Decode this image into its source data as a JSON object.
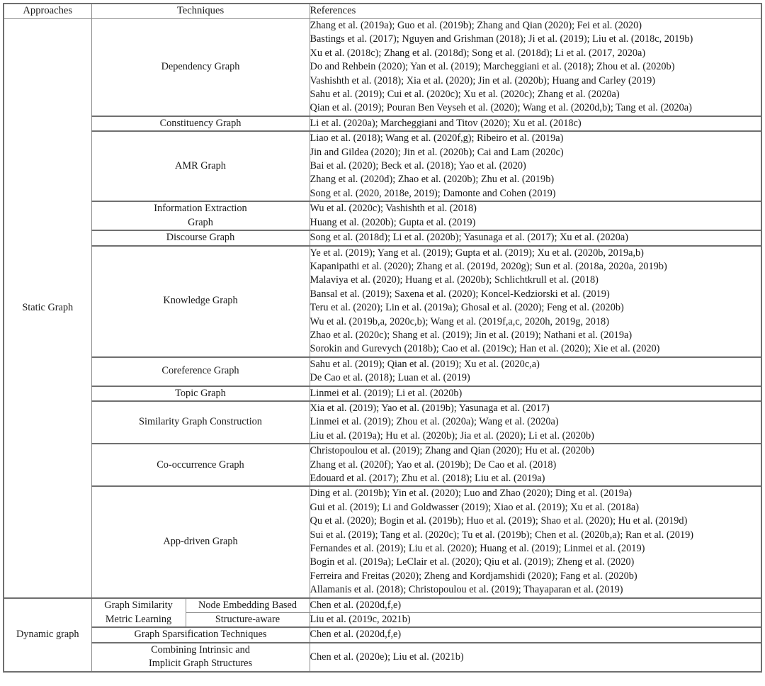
{
  "table": {
    "headers": {
      "approaches": "Approaches",
      "techniques": "Techniques",
      "references": "References"
    },
    "groups": [
      {
        "name": "Static Graph",
        "rows": [
          {
            "technique": "Dependency Graph",
            "references": [
              "Zhang et al. (2019a); Guo et al. (2019b); Zhang and Qian (2020); Fei et al. (2020)",
              "Bastings et al. (2017); Nguyen and Grishman (2018); Ji et al. (2019); Liu et al. (2018c, 2019b)",
              "Xu et al. (2018c); Zhang et al. (2018d); Song et al. (2018d); Li et al. (2017, 2020a)",
              "Do and Rehbein (2020); Yan et al. (2019); Marcheggiani et al. (2018); Zhou et al. (2020b)",
              "Vashishth et al. (2018); Xia et al. (2020); Jin et al. (2020b); Huang and Carley (2019)",
              "Sahu et al. (2019); Cui et al. (2020c); Xu et al. (2020c); Zhang et al. (2020a)",
              "Qian et al. (2019); Pouran Ben Veyseh et al. (2020); Wang et al. (2020d,b); Tang et al. (2020a)"
            ]
          },
          {
            "technique": "Constituency Graph",
            "references": [
              "Li et al. (2020a); Marcheggiani and Titov (2020); Xu et al. (2018c)"
            ]
          },
          {
            "technique": "AMR Graph",
            "references": [
              "Liao et al. (2018); Wang et al. (2020f,g); Ribeiro et al. (2019a)",
              "Jin and Gildea (2020); Jin et al. (2020b); Cai and Lam (2020c)",
              "Bai et al. (2020); Beck et al. (2018); Yao et al. (2020)",
              "Zhang et al. (2020d); Zhao et al. (2020b); Zhu et al. (2019b)",
              "Song et al. (2020, 2018e, 2019); Damonte and Cohen (2019)"
            ]
          },
          {
            "technique": "Information Extraction\nGraph",
            "technique_lines": [
              "Information Extraction",
              "Graph"
            ],
            "references": [
              "Wu et al. (2020c); Vashishth et al. (2018)",
              "Huang et al. (2020b); Gupta et al. (2019)"
            ]
          },
          {
            "technique": "Discourse Graph",
            "references": [
              "Song et al. (2018d); Li et al. (2020b); Yasunaga et al. (2017); Xu et al. (2020a)"
            ]
          },
          {
            "technique": "Knowledge Graph",
            "references": [
              "Ye et al. (2019); Yang et al. (2019); Gupta et al. (2019); Xu et al. (2020b, 2019a,b)",
              "Kapanipathi et al. (2020); Zhang et al. (2019d, 2020g); Sun et al. (2018a, 2020a, 2019b)",
              "Malaviya et al. (2020); Huang et al. (2020b); Schlichtkrull et al. (2018)",
              "Bansal et al. (2019); Saxena et al. (2020); Koncel-Kedziorski et al. (2019)",
              "Teru et al. (2020); Lin et al. (2019a); Ghosal et al. (2020); Feng et al. (2020b)",
              "Wu et al. (2019b,a, 2020c,b); Wang et al. (2019f,a,c, 2020h, 2019g, 2018)",
              "Zhao et al. (2020c); Shang et al. (2019); Jin et al. (2019); Nathani et al. (2019a)",
              "Sorokin and Gurevych (2018b); Cao et al. (2019c); Han et al. (2020); Xie et al. (2020)"
            ]
          },
          {
            "technique": "Coreference Graph",
            "references": [
              "Sahu et al. (2019); Qian et al. (2019); Xu et al. (2020c,a)",
              "De Cao et al. (2018); Luan et al. (2019)"
            ]
          },
          {
            "technique": "Topic Graph",
            "references": [
              "Linmei et al. (2019); Li et al. (2020b)"
            ]
          },
          {
            "technique": "Similarity Graph Construction",
            "references": [
              "Xia et al. (2019); Yao et al. (2019b); Yasunaga et al. (2017)",
              "Linmei et al. (2019); Zhou et al. (2020a); Wang et al. (2020a)",
              "Liu et al. (2019a); Hu et al. (2020b); Jia et al. (2020); Li et al. (2020b)"
            ]
          },
          {
            "technique": "Co-occurrence Graph",
            "references": [
              "Christopoulou et al. (2019); Zhang and Qian (2020); Hu et al. (2020b)",
              "Zhang et al. (2020f); Yao et al. (2019b); De Cao et al. (2018)",
              "Edouard et al. (2017); Zhu et al. (2018); Liu et al. (2019a)"
            ]
          },
          {
            "technique": "App-driven Graph",
            "references": [
              "Ding et al. (2019b); Yin et al. (2020); Luo and Zhao (2020); Ding et al. (2019a)",
              "Gui et al. (2019); Li and Goldwasser (2019); Xiao et al. (2019); Xu et al. (2018a)",
              "Qu et al. (2020); Bogin et al. (2019b); Huo et al. (2019); Shao et al. (2020); Hu et al. (2019d)",
              "Sui et al. (2019); Tang et al. (2020c); Tu et al. (2019b); Chen et al. (2020b,a); Ran et al. (2019)",
              "Fernandes et al. (2019); Liu et al. (2020); Huang et al. (2019); Linmei et al. (2019)",
              "Bogin et al. (2019a); LeClair et al. (2020); Qiu et al. (2019); Zheng et al. (2020)",
              "Ferreira and Freitas (2020); Zheng and Kordjamshidi (2020); Fang et al. (2020b)",
              "Allamanis et al. (2018); Christopoulou et al. (2019); Thayaparan et al. (2019)"
            ]
          }
        ]
      },
      {
        "name": "Dynamic graph",
        "rows": [
          {
            "technique_group": "Graph Similarity\nMetric Learning",
            "technique_group_lines": [
              "Graph Similarity",
              "Metric Learning"
            ],
            "subtechnique": "Node Embedding Based",
            "references": [
              "Chen et al. (2020d,f,e)"
            ]
          },
          {
            "subtechnique": "Structure-aware",
            "references": [
              "Liu et al. (2019c, 2021b)"
            ]
          },
          {
            "technique": "Graph Sparsification Techniques",
            "references": [
              "Chen et al. (2020d,f,e)"
            ]
          },
          {
            "technique": "Combining Intrinsic and\nImplicit Graph Structures",
            "technique_lines": [
              "Combining Intrinsic and",
              "Implicit Graph Structures"
            ],
            "references": [
              "Chen et al. (2020e); Liu et al. (2021b)"
            ]
          }
        ]
      }
    ]
  }
}
